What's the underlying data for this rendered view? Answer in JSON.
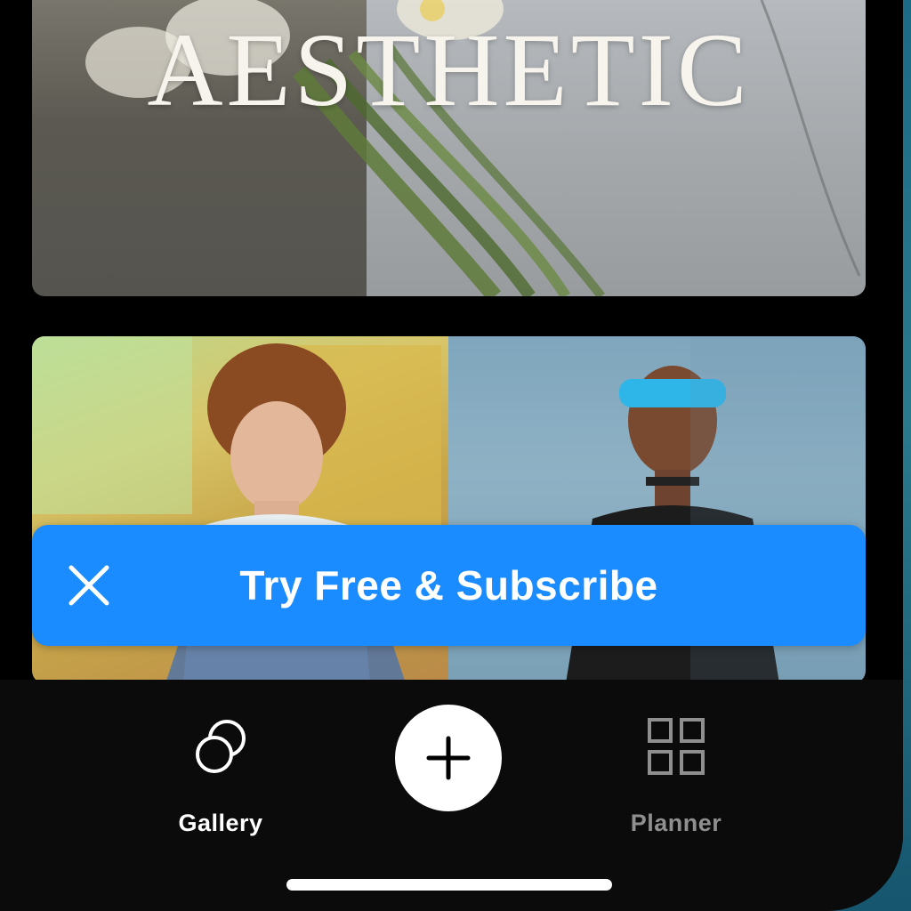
{
  "cards": {
    "aesthetic": {
      "title": "AESTHETIC"
    }
  },
  "banner": {
    "label": "Try Free & Subscribe",
    "close_icon": "close-icon",
    "background_color": "#1a8cff"
  },
  "tabbar": {
    "items": [
      {
        "label": "Gallery",
        "icon": "overlapping-circles-icon",
        "active": true
      },
      {
        "label": "Planner",
        "icon": "grid-icon",
        "active": false
      }
    ],
    "add_icon": "plus-icon"
  }
}
